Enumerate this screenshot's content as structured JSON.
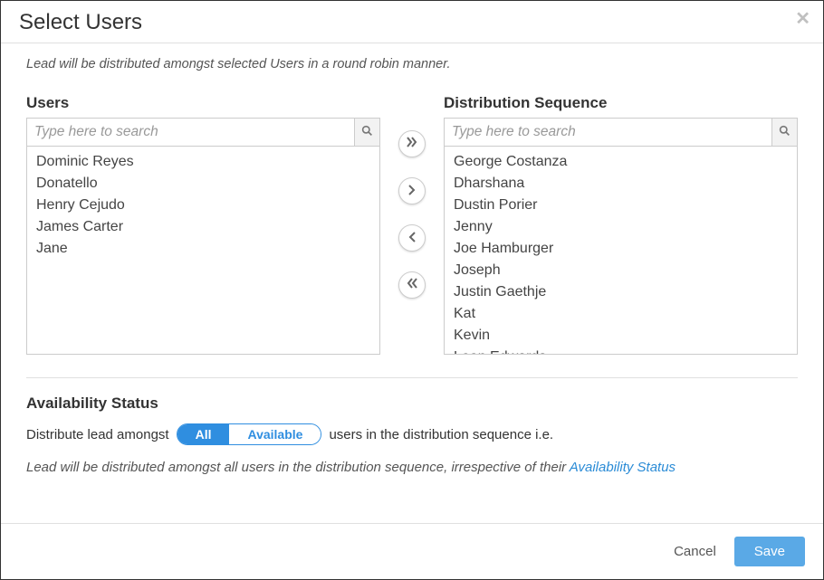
{
  "title": "Select Users",
  "subtitle": "Lead will be distributed amongst selected Users in a round robin manner.",
  "users_panel": {
    "label": "Users",
    "search_placeholder": "Type here to search",
    "items": [
      "Dominic Reyes",
      "Donatello",
      "Henry Cejudo",
      "James Carter",
      "Jane"
    ]
  },
  "sequence_panel": {
    "label": "Distribution Sequence",
    "search_placeholder": "Type here to search",
    "items": [
      "George Costanza",
      "Dharshana",
      "Dustin Porier",
      "Jenny",
      "Joe Hamburger",
      "Joseph",
      "Justin Gaethje",
      "Kat",
      "Kevin",
      "Leon Edwards"
    ]
  },
  "availability": {
    "heading": "Availability Status",
    "prefix": "Distribute lead amongst",
    "option_all": "All",
    "option_available": "Available",
    "suffix": "users in the distribution sequence i.e.",
    "note_prefix": "Lead will be distributed amongst all users in the distribution sequence, irrespective of their ",
    "note_link": "Availability Status"
  },
  "footer": {
    "cancel": "Cancel",
    "save": "Save"
  }
}
